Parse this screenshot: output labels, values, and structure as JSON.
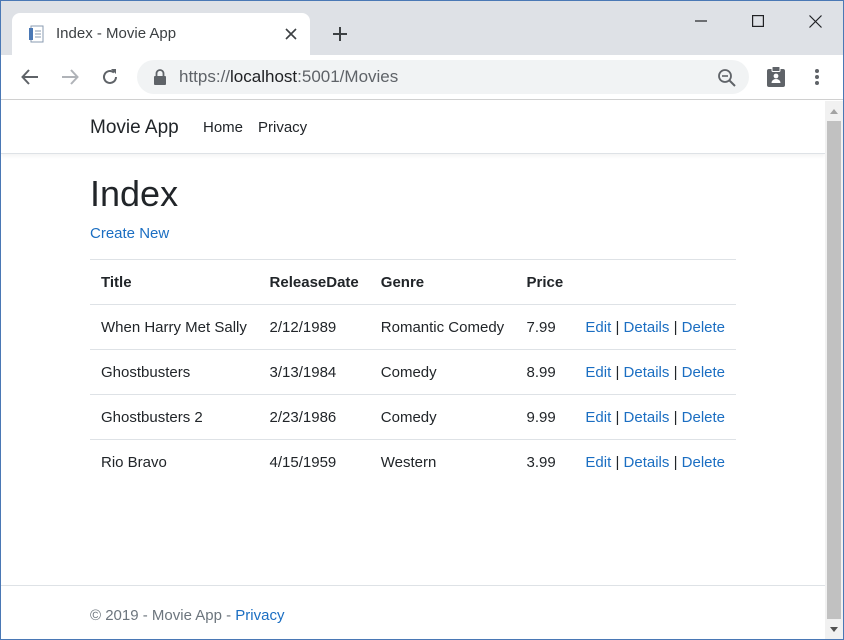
{
  "browser": {
    "tab_title": "Index - Movie App",
    "url_scheme": "https://",
    "url_host": "localhost",
    "url_rest": ":5001/Movies",
    "icons": [
      "page-icon",
      "close-icon",
      "plus-icon",
      "minimize-icon",
      "maximize-icon",
      "close-window-icon",
      "back-icon",
      "forward-icon",
      "reload-icon",
      "lock-icon",
      "zoom-out-icon",
      "clipboard-icon",
      "more-icon"
    ]
  },
  "navbar": {
    "brand": "Movie App",
    "links": [
      "Home",
      "Privacy"
    ]
  },
  "main": {
    "title": "Index",
    "create_link": "Create New",
    "table": {
      "headers": [
        "Title",
        "ReleaseDate",
        "Genre",
        "Price"
      ],
      "rows": [
        {
          "title": "When Harry Met Sally",
          "release": "2/12/1989",
          "genre": "Romantic Comedy",
          "price": "7.99"
        },
        {
          "title": "Ghostbusters",
          "release": "3/13/1984",
          "genre": "Comedy",
          "price": "8.99"
        },
        {
          "title": "Ghostbusters 2",
          "release": "2/23/1986",
          "genre": "Comedy",
          "price": "9.99"
        },
        {
          "title": "Rio Bravo",
          "release": "4/15/1959",
          "genre": "Western",
          "price": "3.99"
        }
      ],
      "actions": {
        "edit": "Edit",
        "details": "Details",
        "delete": "Delete",
        "separator": "|"
      }
    }
  },
  "footer": {
    "text": "© 2019 - Movie App - ",
    "link": "Privacy"
  },
  "colors": {
    "link": "#1b6ec2",
    "tabstrip": "#dee1e6",
    "omnibox": "#f1f3f4"
  }
}
